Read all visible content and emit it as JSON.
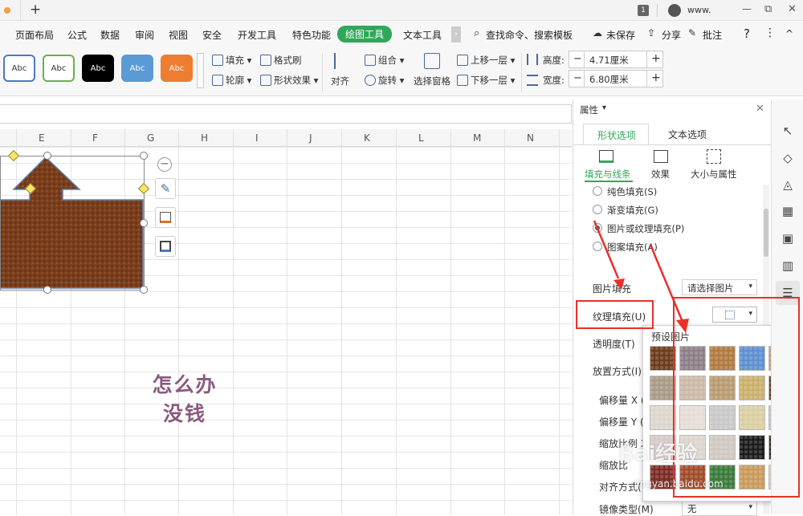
{
  "titlebar": {
    "tab_add": "+",
    "badge": "1",
    "user": "www.",
    "min": "—",
    "max": "⧉",
    "close": "✕"
  },
  "menu": {
    "items": [
      "页面布局",
      "公式",
      "数据",
      "审阅",
      "视图",
      "安全",
      "开发工具",
      "特色功能",
      "绘图工具",
      "文本工具"
    ],
    "search": "查找命令、搜索模板",
    "unsaved": "未保存",
    "share": "分享",
    "comment": "批注",
    "help": "?",
    "more": "⋮",
    "collapse": "^"
  },
  "ribbon": {
    "style_samples": [
      {
        "label": "Abc",
        "bg": "#ffffff",
        "fg": "#333333",
        "border": "#4a78c8"
      },
      {
        "label": "Abc",
        "bg": "#ffffff",
        "fg": "#333333",
        "border": "#6ab04c"
      },
      {
        "label": "Abc",
        "bg": "#000000",
        "fg": "#ffffff",
        "border": "#000000"
      },
      {
        "label": "Abc",
        "bg": "#5b9bd5",
        "fg": "#ffffff",
        "border": "#5b9bd5"
      },
      {
        "label": "Abc",
        "bg": "#ed7d31",
        "fg": "#ffffff",
        "border": "#ed7d31"
      }
    ],
    "fill": "填充",
    "format_painter": "格式刷",
    "outline": "轮廓",
    "shape_effect": "形状效果",
    "align": "对齐",
    "group": "组合",
    "rotate": "旋转",
    "selection_pane": "选择窗格",
    "bring_forward": "上移一层",
    "send_backward": "下移一层",
    "height_label": "高度:",
    "height_value": "4.71厘米",
    "width_label": "宽度:",
    "width_value": "6.80厘米",
    "minus": "−",
    "plus": "+"
  },
  "sheet": {
    "columns": [
      "E",
      "F",
      "G",
      "H",
      "I",
      "J",
      "K",
      "L",
      "M",
      "N"
    ],
    "overlay_line1": "怎么办",
    "overlay_line2": "没钱",
    "shape_colors": {
      "fill": "#7b3f1e",
      "outline": "#5a7fb0"
    }
  },
  "panel": {
    "title": "属性",
    "close": "✕",
    "tabs": [
      "形状选项",
      "文本选项"
    ],
    "subtabs": [
      "填充与线条",
      "效果",
      "大小与属性"
    ],
    "fill_options": [
      "纯色填充(S)",
      "渐变填充(G)",
      "图片或纹理填充(P)",
      "图案填充(A)"
    ],
    "selected_fill": "图片或纹理填充(P)",
    "picture_fill_label": "图片填充",
    "picture_fill_value": "请选择图片",
    "texture_fill_label": "纹理填充(U)",
    "transparency_label": "透明度(T)",
    "placement_label": "放置方式(I)",
    "offset_x": "偏移量 X (",
    "offset_y": "偏移量 Y (",
    "scale_x": "缩放比例 X",
    "scale_y": "缩放比",
    "align_mode": "对齐方式(",
    "mirror_label": "镜像类型(M)",
    "mirror_value": "无",
    "preset_title": "预设图片",
    "accent_color": "#2fa85a"
  },
  "textures": [
    "#6b3a1a",
    "#8b7e86",
    "#b07a3e",
    "#5b8fd0",
    "#b89a78",
    "#a89a85",
    "#cbb9a6",
    "#b89b70",
    "#c9b06a",
    "#5a2f18",
    "#dcd6cc",
    "#e6ddd6",
    "#c8c8c8",
    "#d9cfa0",
    "#b8bfc9",
    "#d8c8c8",
    "#dcd5d0",
    "#d0c8c0",
    "#1a1a1a",
    "#2a1a14",
    "#7a2a22",
    "#a04a28",
    "#3a7a3a",
    "#c89a5a",
    "#d0c8b8"
  ],
  "rail_icons": [
    "cursor-icon",
    "shapes-icon",
    "fill-icon",
    "table-icon",
    "grid-icon",
    "chart-icon",
    "settings-icon"
  ],
  "watermark": {
    "main": "Bai经验",
    "sub": "jingyan.baidu.com"
  }
}
